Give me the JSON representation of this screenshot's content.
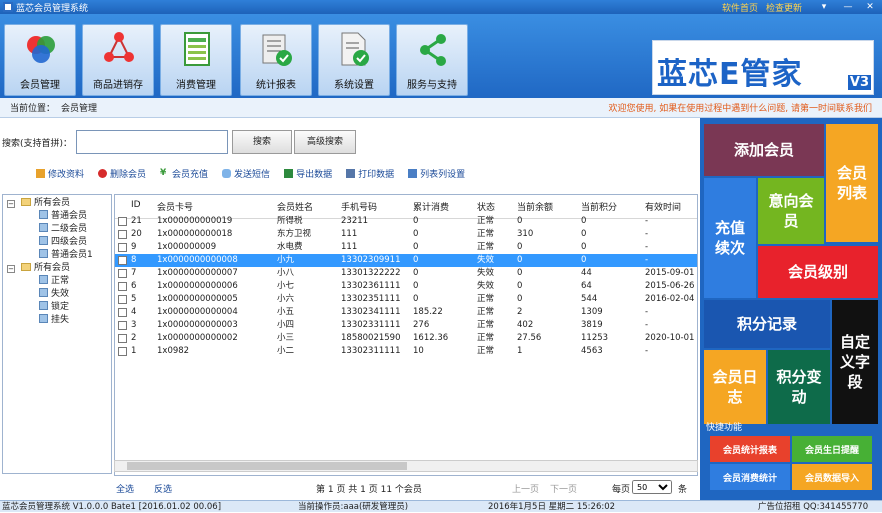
{
  "titlebar": {
    "title": "蓝芯会员管理系统",
    "link1": "软件首页",
    "link2": "检查更新",
    "btn_menu": "▾",
    "btn_min": "—",
    "btn_close": "✕"
  },
  "toolbar": {
    "buttons": [
      {
        "label": "会员管理",
        "icon": "members-icon"
      },
      {
        "label": "商品进销存",
        "icon": "network-icon"
      },
      {
        "label": "消费管理",
        "icon": "spreadsheet-icon"
      },
      {
        "label": "统计报表",
        "icon": "report-icon"
      },
      {
        "label": "系统设置",
        "icon": "settings-doc-icon"
      },
      {
        "label": "服务与支持",
        "icon": "share-icon"
      }
    ],
    "logo_text": "蓝芯E管家",
    "logo_version": "V3"
  },
  "location": {
    "label": "当前位置：",
    "value": "会员管理",
    "marquee": "欢迎您使用, 如果在使用过程中遇到什么问题, 请第一时间联系我们"
  },
  "search": {
    "label": "搜索(支持首拼)：",
    "placeholder": "",
    "search_btn": "搜索",
    "advanced_btn": "高级搜索"
  },
  "actions": [
    {
      "label": "修改资料",
      "icon": "pencil-icon"
    },
    {
      "label": "删除会员",
      "icon": "delete-icon"
    },
    {
      "label": "会员充值",
      "icon": "yen-icon"
    },
    {
      "label": "发送短信",
      "icon": "sms-icon"
    },
    {
      "label": "导出数据",
      "icon": "excel-icon"
    },
    {
      "label": "打印数据",
      "icon": "printer-icon"
    },
    {
      "label": "列表列设置",
      "icon": "columns-icon"
    }
  ],
  "tree": [
    {
      "label": "所有会员",
      "level": 1,
      "type": "folder",
      "toggle": "−"
    },
    {
      "label": "普通会员",
      "level": 2,
      "type": "doc"
    },
    {
      "label": "二级会员",
      "level": 2,
      "type": "doc"
    },
    {
      "label": "四级会员",
      "level": 2,
      "type": "doc"
    },
    {
      "label": "普通会员1",
      "level": 2,
      "type": "doc"
    },
    {
      "label": "所有会员",
      "level": 1,
      "type": "folder",
      "toggle": "−"
    },
    {
      "label": "正常",
      "level": 2,
      "type": "doc"
    },
    {
      "label": "失效",
      "level": 2,
      "type": "doc"
    },
    {
      "label": "锁定",
      "level": 2,
      "type": "doc"
    },
    {
      "label": "挂失",
      "level": 2,
      "type": "doc"
    }
  ],
  "table": {
    "columns": [
      "ID",
      "会员卡号",
      "会员姓名",
      "手机号码",
      "累计消费",
      "状态",
      "当前余额",
      "当前积分",
      "有效时间"
    ],
    "selected_row": 3,
    "rows": [
      [
        "21",
        "1x000000000019",
        "所得税",
        "23211",
        "0",
        "正常",
        "0",
        "0",
        "-"
      ],
      [
        "20",
        "1x000000000018",
        "东方卫视",
        "111",
        "0",
        "正常",
        "310",
        "0",
        "-"
      ],
      [
        "9",
        "1x000000009",
        "水电费",
        "111",
        "0",
        "正常",
        "0",
        "0",
        "-"
      ],
      [
        "8",
        "1x0000000000008",
        "小九",
        "13302309911",
        "0",
        "失效",
        "0",
        "0",
        "-"
      ],
      [
        "7",
        "1x0000000000007",
        "小八",
        "13301322222",
        "0",
        "失效",
        "0",
        "44",
        "2015-09-01"
      ],
      [
        "6",
        "1x0000000000006",
        "小七",
        "13302361111",
        "0",
        "失效",
        "0",
        "64",
        "2015-06-26"
      ],
      [
        "5",
        "1x0000000000005",
        "小六",
        "13302351111",
        "0",
        "正常",
        "0",
        "544",
        "2016-02-04"
      ],
      [
        "4",
        "1x0000000000004",
        "小五",
        "13302341111",
        "185.22",
        "正常",
        "2",
        "1309",
        "-"
      ],
      [
        "3",
        "1x0000000000003",
        "小四",
        "13302331111",
        "276",
        "正常",
        "402",
        "3819",
        "-"
      ],
      [
        "2",
        "1x0000000000002",
        "小三",
        "18580021590",
        "1612.36",
        "正常",
        "27.56",
        "11253",
        "2020-10-01"
      ],
      [
        "1",
        "1x0982",
        "小二",
        "13302311111",
        "10",
        "正常",
        "1",
        "4563",
        "-"
      ]
    ]
  },
  "pager": {
    "select_all": "全选",
    "invert": "反选",
    "page_info": "第 1 页  共 1 页  11 个会员",
    "prev": "上一页",
    "next": "下一页",
    "per_page_label": "每页",
    "per_page_value": "50",
    "per_page_unit": "条"
  },
  "rightpanel": {
    "tiles": [
      "添加会员",
      "会员列表",
      "充值续次",
      "意向会员",
      "会员级别",
      "积分记录",
      "自定义字段",
      "会员日志",
      "积分变动"
    ],
    "quick_label": "快捷功能",
    "quick": [
      "会员统计报表",
      "会员生日提醒",
      "会员消费统计",
      "会员数据导入"
    ],
    "colors": {
      "add": "#7a3754",
      "list": "#f5a623",
      "recharge": "#2f7de0",
      "intent": "#74b620",
      "level": "#e8222c",
      "points": "#1a56b0",
      "custom": "#111111",
      "log": "#f5a623",
      "change": "#0e6b4a",
      "q1": "#e8412c",
      "q2": "#47b035",
      "q3": "#2f7de0",
      "q4": "#f5a623"
    }
  },
  "statusbar": {
    "version": "蓝芯会员管理系统 V1.0.0.0 Bate1 [2016.01.02 00.06]",
    "operator": "当前操作员:aaa(研发管理员)",
    "datetime": "2016年1月5日  星期二  15:26:02",
    "ad": "广告位招租 QQ:341455770"
  }
}
